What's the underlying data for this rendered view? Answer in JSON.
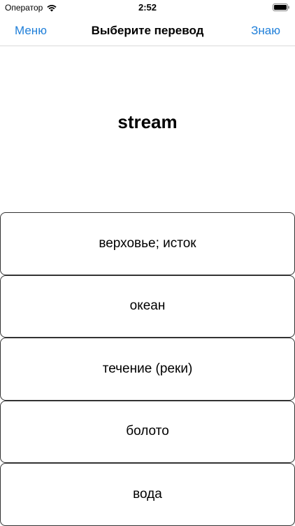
{
  "status_bar": {
    "carrier": "Оператор",
    "time": "2:52",
    "wifi_icon": "wifi-icon",
    "battery_icon": "battery-icon"
  },
  "nav": {
    "left_label": "Меню",
    "title": "Выберите перевод",
    "right_label": "Знаю",
    "accent_color": "#1f7fd9"
  },
  "card": {
    "word": "stream"
  },
  "options": [
    {
      "label": "верховье; исток"
    },
    {
      "label": "океан"
    },
    {
      "label": "течение (реки)"
    },
    {
      "label": "болото"
    },
    {
      "label": "вода"
    }
  ]
}
